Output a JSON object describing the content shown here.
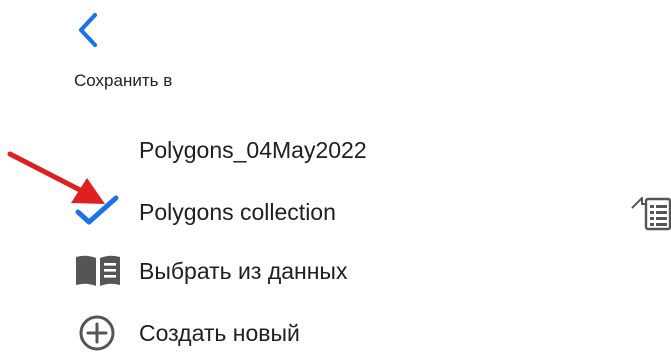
{
  "header": {
    "back_icon": "chevron-left-icon",
    "title": "Сохранить в"
  },
  "items": [
    {
      "label": "Polygons_04May2022",
      "icon": ""
    },
    {
      "label": "Polygons collection",
      "icon": "checkmark-icon",
      "selected": true,
      "trailing_icon": "layer-list-icon"
    },
    {
      "label": "Выбрать из данных",
      "icon": "book-icon"
    },
    {
      "label": "Создать новый",
      "icon": "plus-circle-icon"
    }
  ],
  "colors": {
    "accent": "#1a73e8",
    "arrow": "#e02020",
    "icon": "#555555"
  }
}
